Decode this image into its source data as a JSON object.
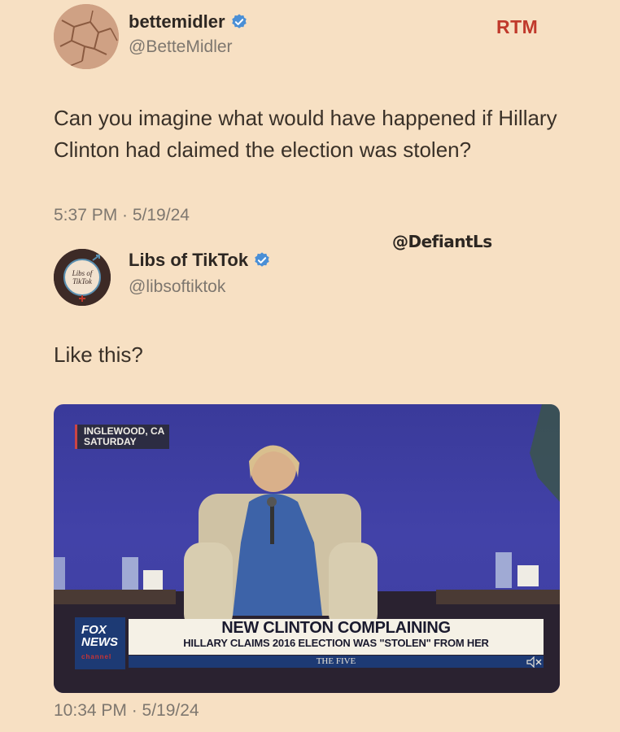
{
  "tweet1": {
    "display_name": "bettemidler",
    "handle": "@BetteMidler",
    "text": "Can you imagine what would have happened if Hillary Clinton had claimed the election was stolen?",
    "timestamp": "5:37 PM · 5/19/24"
  },
  "rtm_label": "RTM",
  "watermark": "@DefiantLs",
  "tweet2": {
    "display_name": "Libs of TikTok",
    "handle": "@libsoftiktok",
    "avatar_text_1": "Libs of",
    "avatar_text_2": "TikTok",
    "text": "Like this?",
    "timestamp": "10:34 PM · 5/19/24"
  },
  "video": {
    "location_line1": "INGLEWOOD, CA",
    "location_line2": "SATURDAY",
    "network_line1": "FOX",
    "network_line2": "NEWS",
    "network_line3": "channel",
    "headline": "NEW CLINTON COMPLAINING",
    "subheadline": "HILLARY CLAIMS 2016 ELECTION WAS \"STOLEN\" FROM HER",
    "show_name": "THE FIVE"
  },
  "colors": {
    "background": "#f7e0c3",
    "verified": "#4a8fd6",
    "rtm": "#c0392b"
  },
  "icons": {
    "verified": "verified-badge-icon",
    "mute": "speaker-muted-icon"
  }
}
